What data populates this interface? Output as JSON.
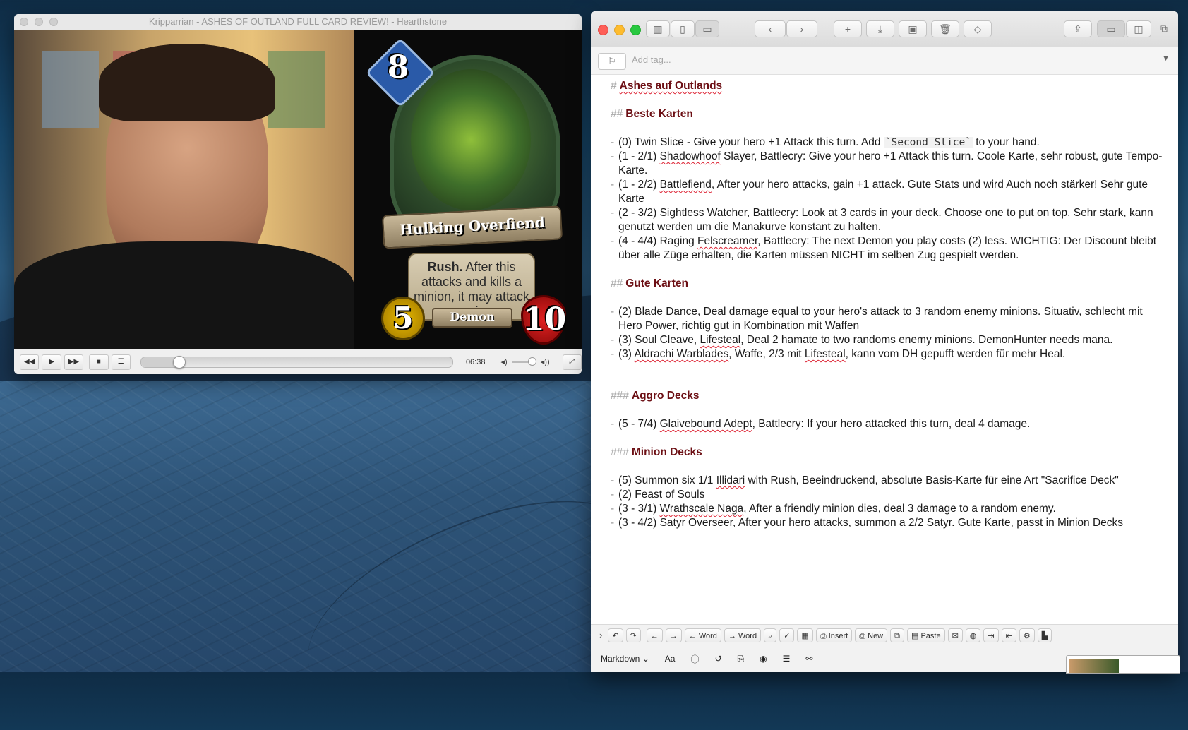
{
  "player": {
    "window_title": "Kripparrian - ASHES OF OUTLAND FULL CARD REVIEW! - Hearthstone",
    "time": "06:38",
    "progress": 0.12,
    "volume": 0.8,
    "card": {
      "mana": "8",
      "name": "Hulking Overfiend",
      "text_bold": "Rush.",
      "text": "After this attacks and kills a minion, it may attack again.",
      "tribe": "Demon",
      "attack": "5",
      "health": "10"
    }
  },
  "editor": {
    "tag_placeholder": "Add tag...",
    "doc": {
      "h1": {
        "hash": "#",
        "text": "Ashes auf Outlands"
      },
      "h2_best": {
        "hash": "##",
        "text": "Beste Karten"
      },
      "best": [
        {
          "dash": "-",
          "a": "(0) Twin Slice - Give your hero +1 Attack this turn. Add ",
          "code": "`Second Slice`",
          "b": " to your hand."
        },
        {
          "dash": "-",
          "a": "(1 - 2/1) ",
          "sq": "Shadowhoof",
          "b": " Slayer, Battlecry: Give your hero +1 Attack this turn. Coole Karte, sehr robust, gute Tempo-Karte."
        },
        {
          "dash": "-",
          "a": "(1 - 2/2) ",
          "sq": "Battlefiend",
          "b": ", After your hero attacks, gain +1 attack. Gute Stats und wird Auch noch stärker! Sehr gute Karte"
        },
        {
          "dash": "-",
          "a": "(2 - 3/2) Sightless Watcher, Battlecry: Look at 3 cards in your deck. Choose one to put on top. Sehr stark, kann genutzt werden um die Manakurve konstant zu halten.",
          "sq": "",
          "b": ""
        },
        {
          "dash": "-",
          "a": "(4 - 4/4) Raging ",
          "sq": "Felscreamer",
          "b": ", Battlecry: The next Demon you play costs (2) less. WICHTIG: Der Discount bleibt über alle Züge erhalten, die Karten müssen NICHT im selben Zug gespielt werden."
        }
      ],
      "h2_good": {
        "hash": "##",
        "text": "Gute Karten"
      },
      "good": [
        {
          "dash": "-",
          "a": "(2) Blade Dance, Deal damage equal to your hero's attack to 3 random enemy minions. Situativ, schlecht mit Hero Power, richtig gut in Kombination mit Waffen",
          "sq": "",
          "b": ""
        },
        {
          "dash": "-",
          "a": "(3) Soul Cleave, ",
          "sq": "Lifesteal",
          "b": ", Deal 2 hamate to two randoms enemy minions. DemonHunter needs mana."
        },
        {
          "dash": "-",
          "a": "(3) ",
          "sq": "Aldrachi Warblades",
          "b": ", Waffe, 2/3 mit ",
          "sq2": "Lifesteal",
          "c": ", kann vom DH gepufft werden für mehr Heal."
        }
      ],
      "h3_aggro": {
        "hash": "###",
        "text": "Aggro Decks"
      },
      "aggro": [
        {
          "dash": "-",
          "a": "(5 - 7/4) ",
          "sq": "Glaivebound Adept",
          "b": ", Battlecry: If your hero attacked this turn, deal 4 damage."
        }
      ],
      "h3_minion": {
        "hash": "###",
        "text": "Minion Decks"
      },
      "minion": [
        {
          "dash": "-",
          "a": "(5) Summon six 1/1 ",
          "sq": "Illidari",
          "b": " with Rush, Beeindruckend, absolute Basis-Karte für eine Art \"Sacrifice Deck\""
        },
        {
          "dash": "-",
          "a": "(2) Feast of Souls",
          "sq": "",
          "b": ""
        },
        {
          "dash": "-",
          "a": "(3 - 3/1) ",
          "sq": "Wrathscale Naga",
          "b": ", After a friendly minion dies, deal 3 damage to a random enemy."
        },
        {
          "dash": "-",
          "a": "(3 - 4/2) Satyr Overseer, After your hero attacks, summon a 2/2 Satyr. Gute Karte, passt in Minion Decks",
          "sq": "",
          "b": ""
        }
      ]
    },
    "bottom_toolbar": {
      "word_back": "Word",
      "word_fwd": "Word",
      "insert": "Insert",
      "new": "New",
      "paste": "Paste"
    },
    "status": {
      "mode": "Markdown",
      "font": "Aa"
    }
  }
}
